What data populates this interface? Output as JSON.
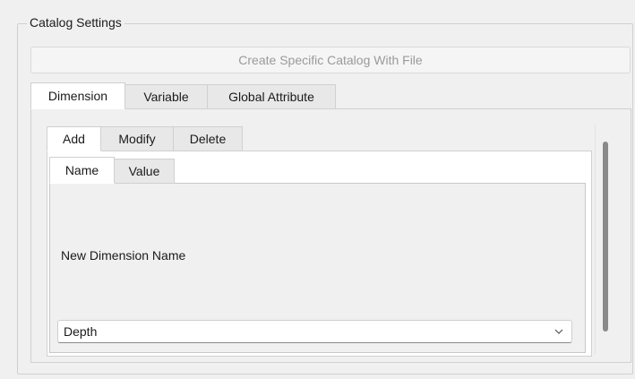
{
  "groupbox": {
    "title": "Catalog Settings"
  },
  "create_button": {
    "label": "Create Specific Catalog With File",
    "enabled": false
  },
  "main_tabs": [
    {
      "label": "Dimension",
      "active": true
    },
    {
      "label": "Variable",
      "active": false
    },
    {
      "label": "Global Attribute",
      "active": false
    }
  ],
  "action_tabs": [
    {
      "label": "Add",
      "active": true
    },
    {
      "label": "Modify",
      "active": false
    },
    {
      "label": "Delete",
      "active": false
    }
  ],
  "field_tabs": [
    {
      "label": "Name",
      "active": true
    },
    {
      "label": "Value",
      "active": false
    }
  ],
  "name_field": {
    "label": "New Dimension Name",
    "selected_value": "Depth",
    "icon": "chevron-down-icon"
  },
  "colors": {
    "background": "#f0f0f0",
    "disabled_text": "#9a9a9a",
    "scroll_thumb": "#8a8a8a"
  }
}
